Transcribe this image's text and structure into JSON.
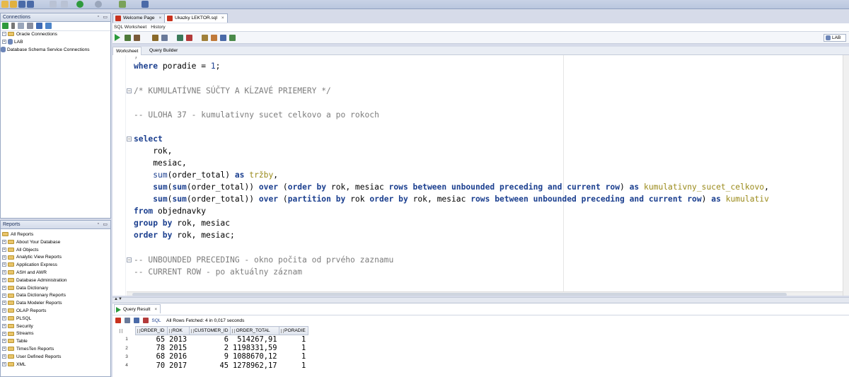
{
  "connections_panel": {
    "title": "Connections",
    "tree": [
      {
        "label": "Oracle Connections",
        "level": 0
      },
      {
        "label": "LAB",
        "level": 1
      },
      {
        "label": "Database Schema Service Connections",
        "level": 0
      }
    ]
  },
  "reports_panel": {
    "title": "Reports",
    "items": [
      "All Reports",
      "About Your Database",
      "All Objects",
      "Analytic View Reports",
      "Application Express",
      "ASH and AWR",
      "Database Administration",
      "Data Dictionary",
      "Data Dictionary Reports",
      "Data Modeler Reports",
      "OLAP Reports",
      "PLSQL",
      "Security",
      "Streams",
      "Table",
      "TimesTen Reports",
      "User Defined Reports",
      "XML"
    ]
  },
  "editor_tabs": [
    {
      "label": "Welcome Page",
      "active": false
    },
    {
      "label": "Ukazky LEKTOR.sql",
      "active": true
    }
  ],
  "sub_tabs": [
    "SQL Worksheet",
    "History"
  ],
  "worksheet_tabs": [
    "Worksheet",
    "Query Builder"
  ],
  "connection_selector": "LAB",
  "code": {
    "line1": "where poradie = 1;",
    "line2": "/* KUMULATÍVNE SÚČTY A KĹZAVÉ PRIEMERY */",
    "line3": "-- ULOHA 37 - kumulativny sucet celkovo a po rokoch",
    "line4": "select",
    "line5": "    rok,",
    "line6": "    mesiac,",
    "line7": "    sum(order_total) as tržby,",
    "line8": "    sum(sum(order_total)) over (order by rok, mesiac rows between unbounded preceding and current row) as kumulativny_sucet_celkovo,",
    "line9": "    sum(sum(order_total)) over (partition by rok order by rok, mesiac rows between unbounded preceding and current row) as kumulativ",
    "line10": "from objednavky",
    "line11": "group by rok, mesiac",
    "line12": "order by rok, mesiac;",
    "line13": "-- UNBOUNDED PRECEDING - okno počita od prvého zaznamu",
    "line14": "-- CURRENT ROW - po aktuálny záznam"
  },
  "results": {
    "tab_label": "Query Result",
    "toolbar_sql": "SQL",
    "status": "All Rows Fetched: 4 in 0,017 seconds",
    "columns": [
      "ORDER_ID",
      "ROK",
      "CUSTOMER_ID",
      "ORDER_TOTAL",
      "PORADIE"
    ],
    "rows": [
      {
        "n": "1",
        "order_id": "65",
        "rok": "2013",
        "customer_id": "6",
        "order_total": "514267,91",
        "poradie": "1"
      },
      {
        "n": "2",
        "order_id": "78",
        "rok": "2015",
        "customer_id": "2",
        "order_total": "1198331,59",
        "poradie": "1"
      },
      {
        "n": "3",
        "order_id": "68",
        "rok": "2016",
        "customer_id": "9",
        "order_total": "1088670,12",
        "poradie": "1"
      },
      {
        "n": "4",
        "order_id": "70",
        "rok": "2017",
        "customer_id": "45",
        "order_total": "1278962,17",
        "poradie": "1"
      }
    ]
  },
  "colors": {
    "keyword": "#1b3f8f",
    "comment": "#7d7d7d",
    "alias": "#9a8a1a",
    "run_green": "#2a9a3b"
  }
}
